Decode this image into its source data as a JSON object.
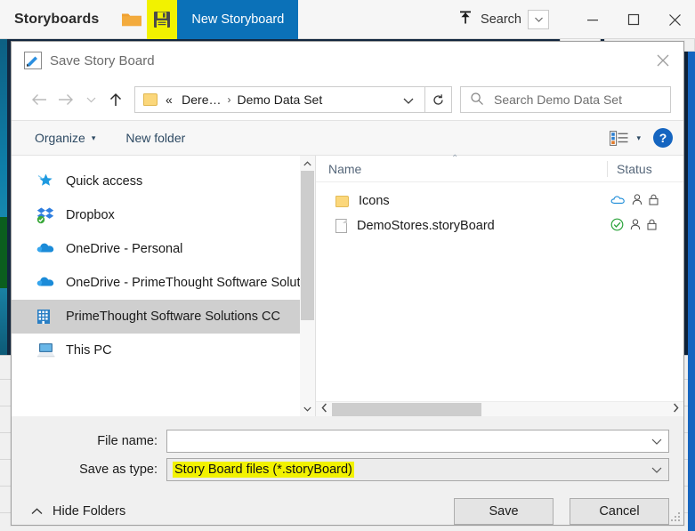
{
  "app": {
    "title": "Storyboards",
    "toolbar_icons": [
      {
        "name": "open-folder-icon",
        "glyph": "folder"
      },
      {
        "name": "save-icon",
        "glyph": "floppy",
        "highlighted": true
      }
    ],
    "active_tab": "New Storyboard",
    "search_label": "Search",
    "window_buttons": {
      "minimize": "—",
      "maximize": "□",
      "close": "✕"
    },
    "accent_blue": "#0b71b8",
    "highlight_yellow": "#f2f200"
  },
  "dialog": {
    "title": "Save Story Board",
    "close_label": "✕",
    "nav": {
      "back": "←",
      "forward": "→",
      "recent": "⌄",
      "up": "↑",
      "breadcrumb": {
        "overflow": "«",
        "parts": [
          "Dere…",
          "Demo Data Set"
        ],
        "separator": "›",
        "dropdown": "⌄"
      },
      "refresh": "↻",
      "search_placeholder": "Search Demo Data Set"
    },
    "toolbar": {
      "organize": "Organize",
      "organize_caret": "▾",
      "new_folder": "New folder",
      "view_caret": "▾",
      "help": "?"
    },
    "sidebar": {
      "items": [
        {
          "label": "Quick access",
          "icon": "star-pin-icon",
          "selected": false
        },
        {
          "label": "Dropbox",
          "icon": "dropbox-icon",
          "selected": false
        },
        {
          "label": "OneDrive - Personal",
          "icon": "onedrive-cloud-icon",
          "selected": false
        },
        {
          "label": "OneDrive - PrimeThought Software Soluti",
          "icon": "onedrive-cloud-icon",
          "selected": false
        },
        {
          "label": "PrimeThought Software Solutions CC",
          "icon": "building-icon",
          "selected": true
        },
        {
          "label": "This PC",
          "icon": "this-pc-icon",
          "selected": false
        }
      ],
      "scroll_up": "∧",
      "scroll_down": "∨"
    },
    "filelist": {
      "columns": {
        "name": "Name",
        "status": "Status"
      },
      "sort_indicator": "⌃",
      "rows": [
        {
          "name": "Icons",
          "icon": "folder-icon",
          "status_icons": [
            "cloud-icon",
            "person-icon",
            "lock-icon"
          ]
        },
        {
          "name": "DemoStores.storyBoard",
          "icon": "document-icon",
          "status_icons": [
            "check-circle-icon",
            "person-icon",
            "lock-icon"
          ]
        }
      ],
      "hscroll_left": "‹",
      "hscroll_right": "›"
    },
    "form": {
      "file_name_label": "File name:",
      "file_name_value": "",
      "save_as_type_label": "Save as type:",
      "save_as_type_value": "Story Board files (*.storyBoard)",
      "dropdown_caret": "⌄"
    },
    "footer": {
      "hide_folders": "Hide Folders",
      "hide_folders_caret": "⌃",
      "save": "Save",
      "cancel": "Cancel"
    }
  }
}
